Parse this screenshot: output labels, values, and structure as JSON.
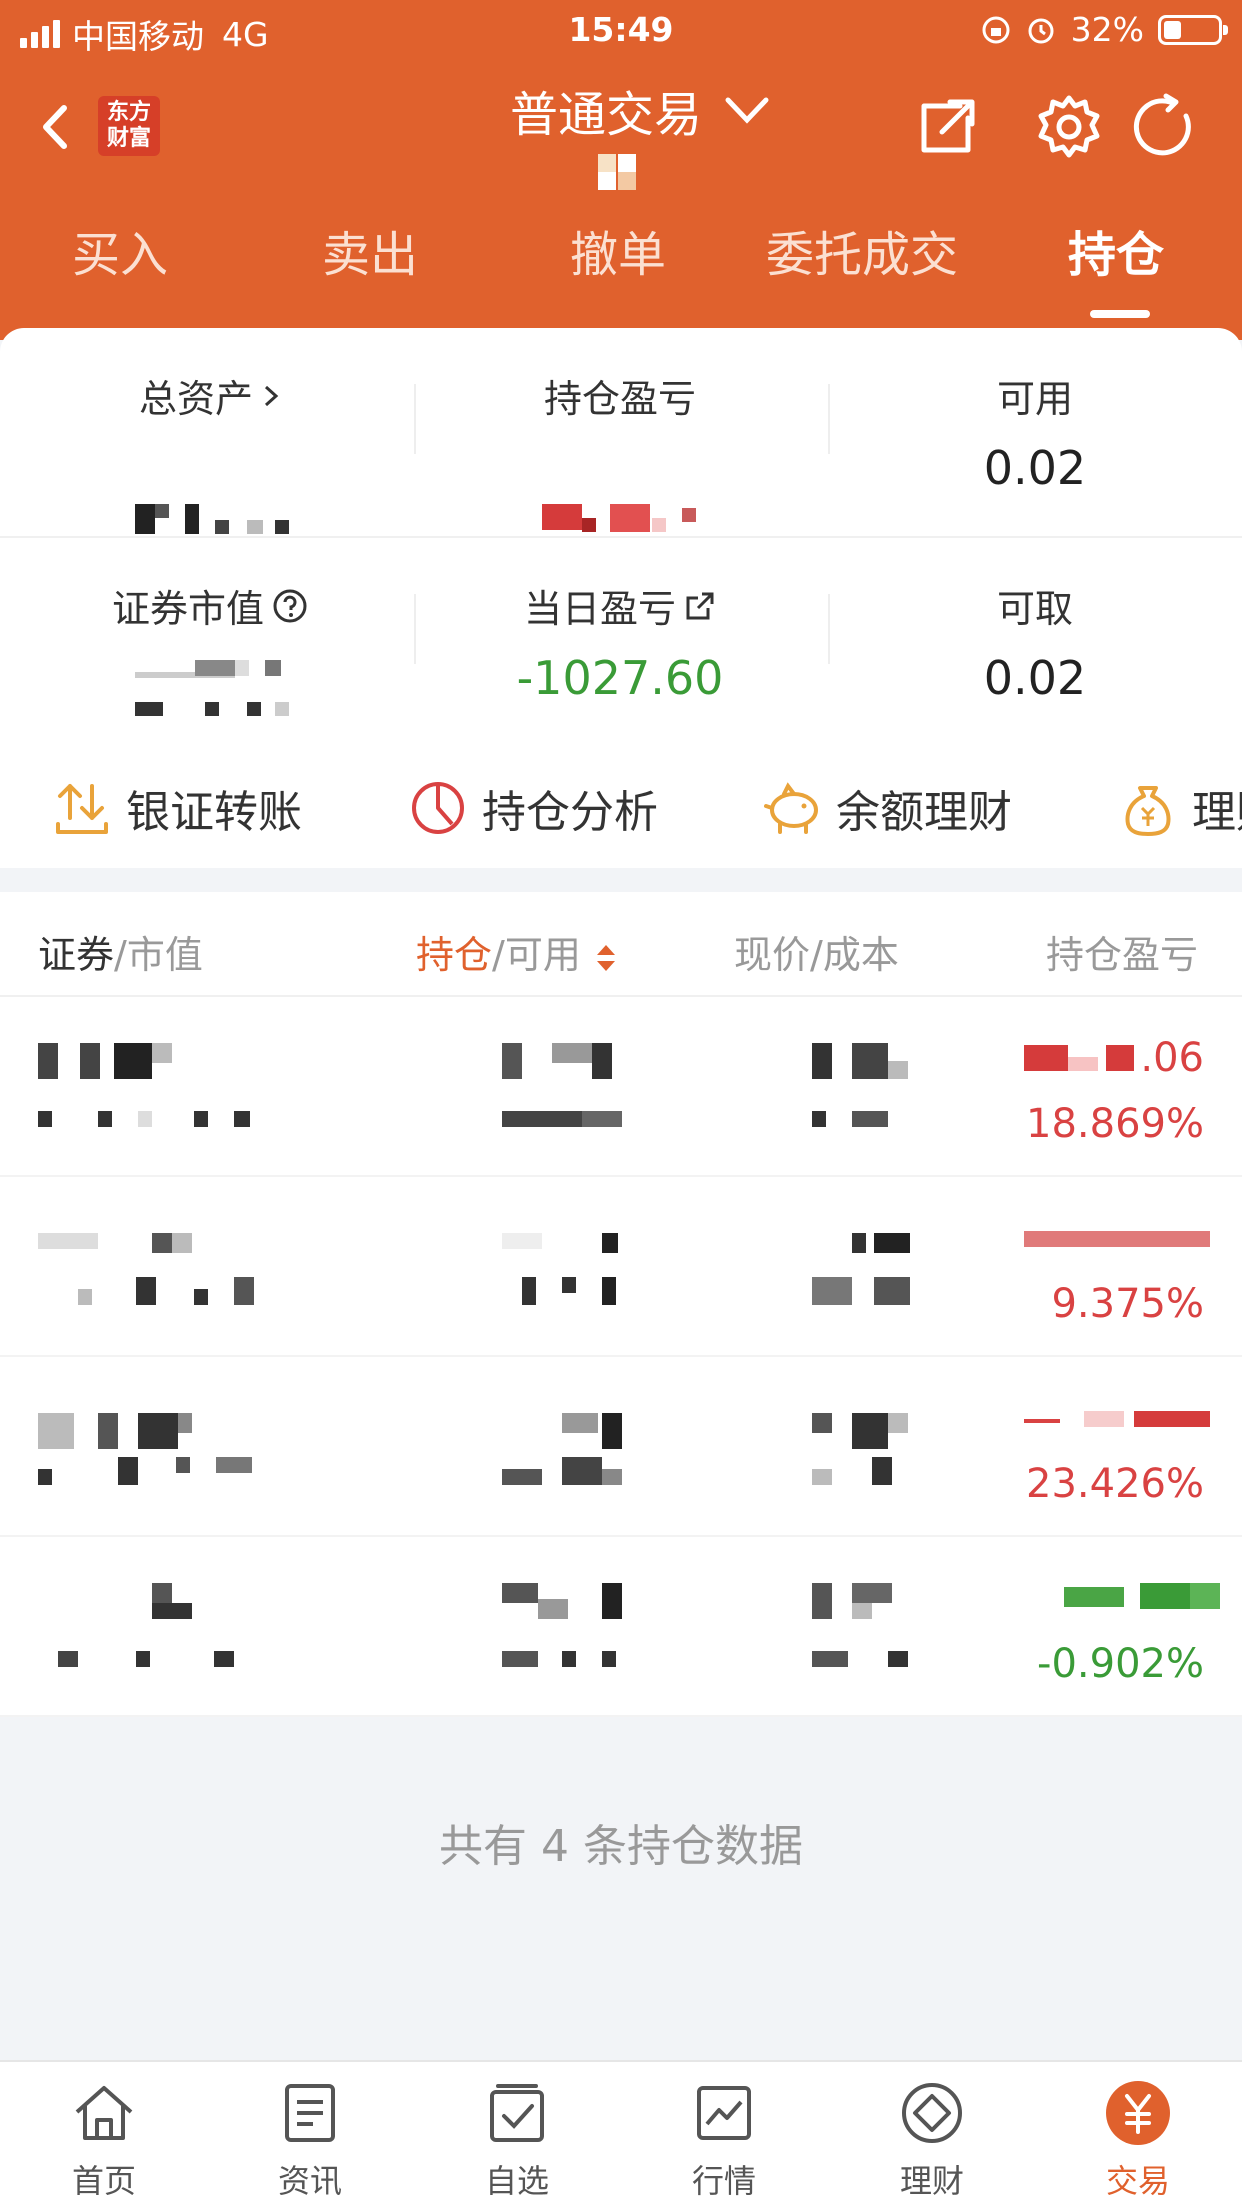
{
  "status_bar": {
    "carrier": "中国移动",
    "network": "4G",
    "time": "15:49",
    "battery_percent": "32%",
    "battery_level": 0.32
  },
  "header": {
    "logo_text_line1": "东方",
    "logo_text_line2": "财富",
    "title": "普通交易",
    "tabs": [
      "买入",
      "卖出",
      "撤单",
      "委托成交",
      "持仓"
    ],
    "active_tab": "持仓"
  },
  "summary": {
    "total_assets_label": "总资产",
    "position_pnl_label": "持仓盈亏",
    "available_label": "可用",
    "available_value": "0.02",
    "market_value_label": "证券市值",
    "daily_pnl_label": "当日盈亏",
    "daily_pnl_value": "-1027.60",
    "withdrawable_label": "可取",
    "withdrawable_value": "0.02"
  },
  "quick_actions": [
    {
      "label": "银证转账",
      "icon": "transfer-icon"
    },
    {
      "label": "持仓分析",
      "icon": "pie-chart-icon"
    },
    {
      "label": "余额理财",
      "icon": "piggy-bank-icon"
    },
    {
      "label": "理财",
      "icon": "money-bag-icon"
    }
  ],
  "table": {
    "col1_main": "证券",
    "col1_sub": "/市值",
    "col2_main": "持仓",
    "col2_sub": "/可用",
    "col3_main": "现价",
    "col3_sub": "/成本",
    "col4_main": "持仓盈亏",
    "rows": [
      {
        "pnl_amount": ".06",
        "pnl_pct": "18.869%",
        "trend": "up"
      },
      {
        "pnl_amount": "",
        "pnl_pct": "9.375%",
        "trend": "up"
      },
      {
        "pnl_amount": "",
        "pnl_pct": "23.426%",
        "trend": "up"
      },
      {
        "pnl_amount": "",
        "pnl_pct": "-0.902%",
        "trend": "down"
      }
    ]
  },
  "footer_text": "共有 4 条持仓数据",
  "bottom_tabs": [
    {
      "label": "首页",
      "icon": "home-icon"
    },
    {
      "label": "资讯",
      "icon": "news-icon"
    },
    {
      "label": "自选",
      "icon": "watchlist-icon"
    },
    {
      "label": "行情",
      "icon": "market-icon"
    },
    {
      "label": "理财",
      "icon": "wealth-icon"
    },
    {
      "label": "交易",
      "icon": "trade-icon"
    }
  ],
  "colors": {
    "brand": "#e0612d",
    "up": "#d94242",
    "down": "#3a9b37"
  }
}
